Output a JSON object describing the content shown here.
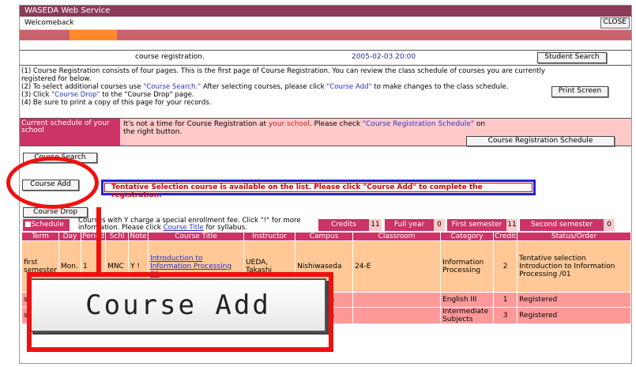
{
  "window": {
    "title": "WASEDA Web Service",
    "welcome": "Welcomeback",
    "close_label": "CLOSE"
  },
  "header": {
    "title": "course registration.",
    "datetime": "2005-02-03 20:00",
    "student_search_label": "Student Search"
  },
  "instructions": {
    "line1": "(1) Course Registration consists of four pages. This is the first page of Course Registration. You can review the class schedule of courses you are currently registered for below.",
    "line2a": "(2) To select additional courses use ",
    "line2b": "\"Course Search.\"",
    "line2c": " After selecting courses, please click ",
    "line2d": "\"Course Add\"",
    "line2e": " to make changes to the class schedule.",
    "line3a": "(3) Click ",
    "line3b": "\"Course Drop\"",
    "line3c": " to the \"Course Drop\" page.",
    "line4": "(4) Be sure to print a copy of this page for your records.",
    "print_label": "Print Screen"
  },
  "current": {
    "label": "Current schedule of your school",
    "msg_a": "It's not a time for Course Registration at ",
    "msg_b": "your school",
    "msg_c": ". Please check ",
    "msg_d": "\"Course Registration Schedule\"",
    "msg_e": " on the right button.",
    "schedule_btn": "Course Registration Schedule"
  },
  "actions": {
    "search": "Course Search",
    "add": "Course Add",
    "drop": "Course Drop"
  },
  "notice": "Tentative Selection course is available on the list. Please click \"Course Add\" to complete the registration.",
  "summary": {
    "schedule_tag": "■Schedule",
    "note_a": "Courses with Y charge a special enrollment fee. Click \"!\" for more information. Please click ",
    "note_b": "Course Title",
    "note_c": " for syllabus.",
    "credits_label": "Credits",
    "credits_value": "11",
    "fullyear_label": "Full year",
    "fullyear_value": "0",
    "first_label": "First semester",
    "first_value": "11",
    "second_label": "Second semester",
    "second_value": "0"
  },
  "table": {
    "headers": [
      "Term",
      "Day",
      "Period",
      "Schl",
      "Note",
      "Course Title",
      "Instructor",
      "Campus",
      "Classroom",
      "Category",
      "Credit",
      "Status/Order"
    ],
    "rows": [
      {
        "term": "first semester",
        "day": "Mon.",
        "period": "1",
        "schl": "MNC",
        "note": "Y !",
        "title": "Introduction to Information Processing 06",
        "instructor": "UEDA, Takashi",
        "campus": "Nishiwaseda",
        "classroom": "24-E",
        "category": "Information Processing",
        "credit": "2",
        "status": "Tentative selection Introduction to Information Processing /01"
      },
      {
        "term": "se",
        "day": "",
        "period": "",
        "schl": "",
        "note": "",
        "title": "",
        "instructor": "",
        "campus": "shiwaseda",
        "classroom": "",
        "category": "English III",
        "credit": "1",
        "status": "Registered"
      },
      {
        "term": "se",
        "day": "",
        "period": "",
        "schl": "",
        "note": "",
        "title": "",
        "instructor": "",
        "campus": "shiwaseda",
        "classroom": "",
        "category": "Intermediate Subjects",
        "credit": "3",
        "status": "Registered"
      }
    ]
  },
  "zoom": {
    "label": "Course Add"
  },
  "colors": {
    "titlebar": "#8b3a5a",
    "accent": "#cc3366",
    "pink": "#ffc9c9",
    "highlight": "#ee1111",
    "notice_border": "#2222dd"
  }
}
